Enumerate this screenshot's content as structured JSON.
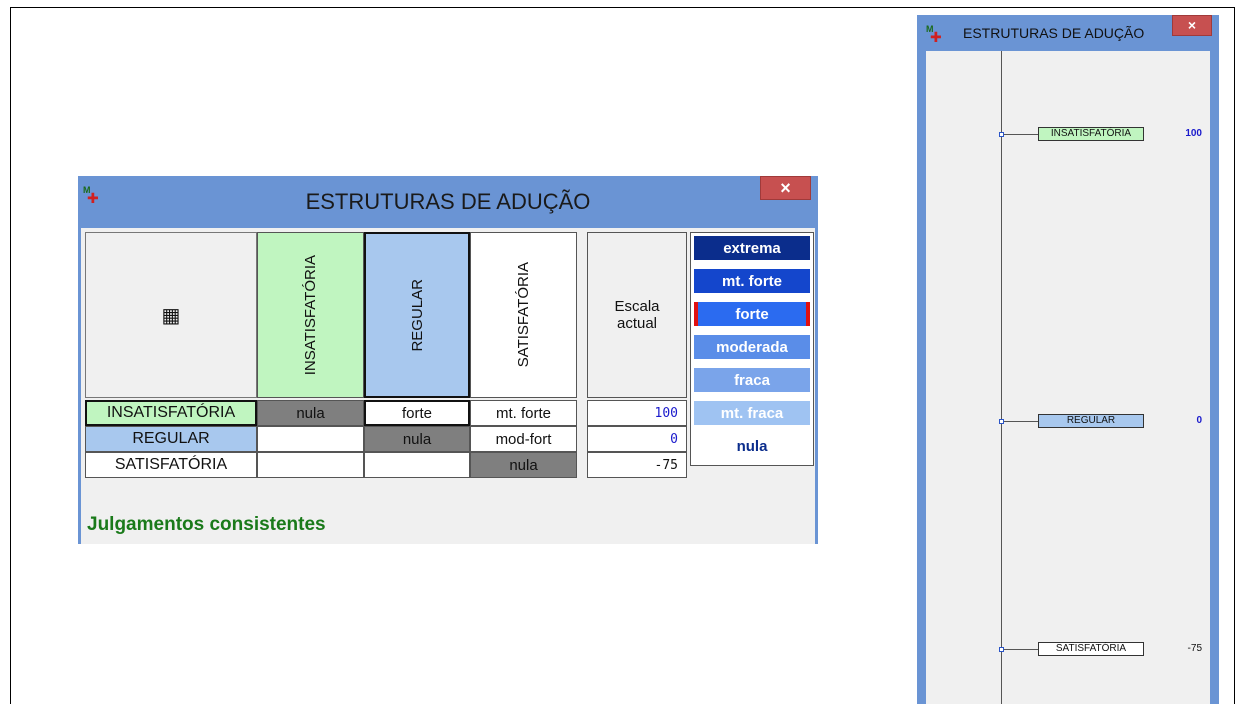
{
  "window_main": {
    "title": "ESTRUTURAS DE ADUÇÃO",
    "close_glyph": "×",
    "corner_icon": "calculator-icon",
    "columns": [
      "INSATISFATÓRIA",
      "REGULAR",
      "SATISFATÓRIA"
    ],
    "scale_header": "Escala actual",
    "rows": [
      {
        "label": "INSATISFATÓRIA",
        "cells": [
          "nula",
          "forte",
          "mt. forte"
        ],
        "scale": "100"
      },
      {
        "label": "REGULAR",
        "cells": [
          "",
          "nula",
          "mod-fort"
        ],
        "scale": "0"
      },
      {
        "label": "SATISFATÓRIA",
        "cells": [
          "",
          "",
          "nula"
        ],
        "scale": "-75"
      }
    ],
    "legend": [
      {
        "label": "extrema",
        "color": "#0b2d8c"
      },
      {
        "label": "mt. forte",
        "color": "#1446cc"
      },
      {
        "label": "forte",
        "color": "#2b6bf0"
      },
      {
        "label": "moderada",
        "color": "#5a8de8"
      },
      {
        "label": "fraca",
        "color": "#7aa4ea"
      },
      {
        "label": "mt. fraca",
        "color": "#9fc3f2"
      },
      {
        "label": "nula",
        "color": "#ffffff"
      }
    ],
    "selected_legend": "forte",
    "status": "Julgamentos consistentes"
  },
  "window_scale": {
    "title": "ESTRUTURAS DE ADUÇÃO",
    "close_glyph": "×",
    "items": [
      {
        "label": "INSATISFATÓRIA",
        "value": "100"
      },
      {
        "label": "REGULAR",
        "value": "0"
      },
      {
        "label": "SATISFATÓRIA",
        "value": "-75"
      }
    ]
  },
  "colors": {
    "insatisfatoria": "#c0f5c0",
    "regular": "#a8c8ee",
    "window_frame": "#6a94d4",
    "status_green": "#1a7a1a"
  }
}
